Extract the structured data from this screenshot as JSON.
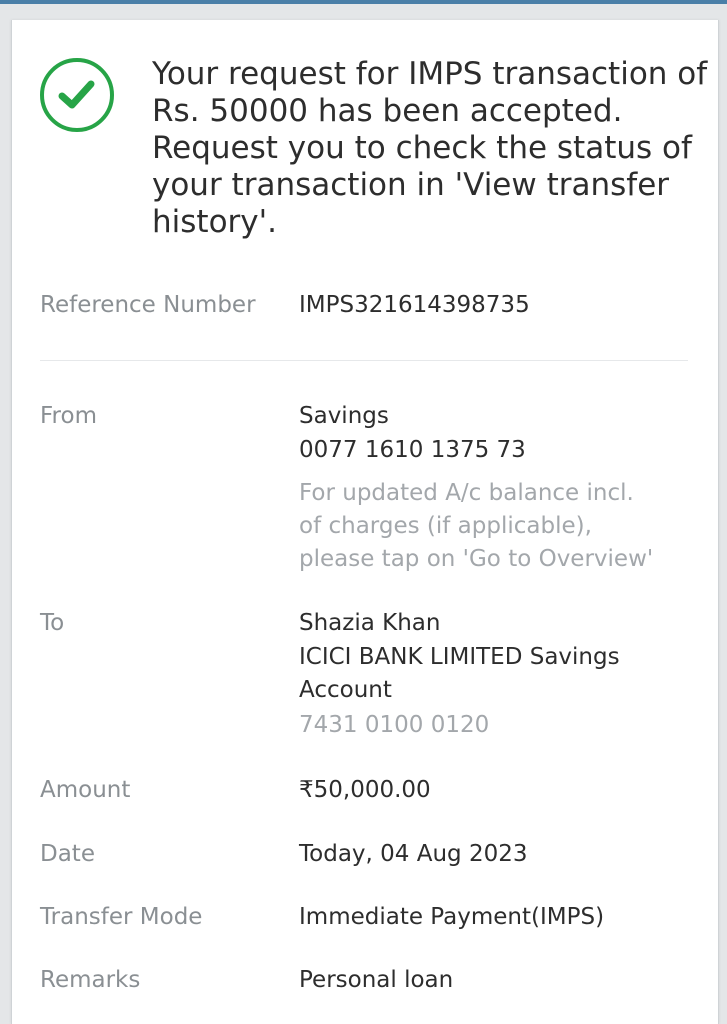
{
  "status": {
    "message": "Your request for IMPS transaction of Rs. 50000 has been accepted. Request you to check the status of your transaction in 'View transfer history'.",
    "icon": "check-circle-icon",
    "accent_color": "#27a447"
  },
  "reference": {
    "label": "Reference Number",
    "value": "IMPS321614398735"
  },
  "from": {
    "label": "From",
    "account_type": "Savings",
    "account_number": "0077 1610 1375 73",
    "note_lines": [
      "For updated A/c balance incl.",
      "of charges (if applicable),",
      "please tap on 'Go to Overview'"
    ]
  },
  "to": {
    "label": "To",
    "name": "Shazia Khan",
    "bank_line1": "ICICI BANK LIMITED Savings",
    "bank_line2": "Account",
    "account_number": "7431 0100 0120"
  },
  "amount": {
    "label": "Amount",
    "value": "₹50,000.00"
  },
  "date": {
    "label": "Date",
    "value": "Today, 04 Aug 2023"
  },
  "transfer_mode": {
    "label": "Transfer Mode",
    "value": "Immediate Payment(IMPS)"
  },
  "remarks": {
    "label": "Remarks",
    "value": "Personal loan"
  }
}
